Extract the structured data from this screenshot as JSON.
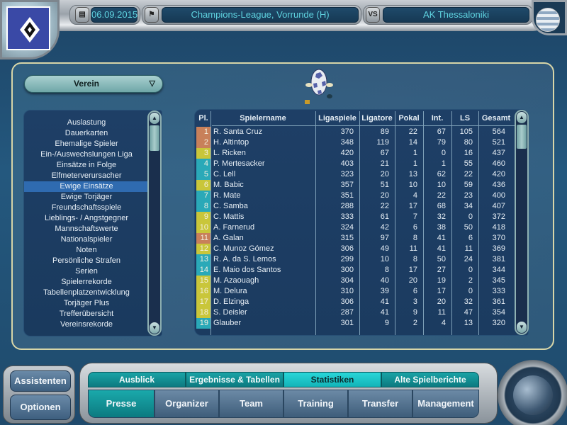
{
  "header": {
    "date": "06.09.2015",
    "competition": "Champions-League, Vorrunde (H)",
    "vs_label": "VS",
    "opponent": "AK Thessaloniki",
    "calendar_icon": "calendar-icon",
    "competition_icon": "flag-ball-icon",
    "club_crest": "hsv-diamond-crest",
    "opponent_flag": "greece-flag"
  },
  "category_dropdown": {
    "selected": "Verein",
    "arrow": "▽"
  },
  "stats_list": {
    "selected_index": 6,
    "items": [
      "Auslastung",
      "Dauerkarten",
      "Ehemalige Spieler",
      "Ein-/Auswechslungen Liga",
      "Einsätze in Folge",
      "Elfmeterverursacher",
      "Ewige Einsätze",
      "Ewige Torjäger",
      "Freundschaftsspiele",
      "Lieblings- / Angstgegner",
      "Mannschaftswerte",
      "Nationalspieler",
      "Noten",
      "Persönliche Strafen",
      "Serien",
      "Spielerrekorde",
      "Tabellenplatzentwicklung",
      "Torjäger Plus",
      "Trefferübersicht",
      "Vereinsrekorde"
    ],
    "scroll_up": "▲",
    "scroll_down": "▼"
  },
  "table": {
    "columns": [
      "Pl.",
      "Spielername",
      "Ligaspiele",
      "Ligatore",
      "Pokal",
      "Int.",
      "LS",
      "Gesamt"
    ],
    "position_colors": {
      "orange": "#c8805a",
      "yellow": "#c9c63a",
      "cyan": "#2aa9b8"
    },
    "rows": [
      {
        "pl": "1",
        "color": "orange",
        "name": "R. Santa Cruz",
        "liga": "370",
        "tore": "89",
        "pokal": "22",
        "int": "67",
        "ls": "105",
        "gesamt": "564"
      },
      {
        "pl": "2",
        "color": "orange",
        "name": "H. Altintop",
        "liga": "348",
        "tore": "119",
        "pokal": "14",
        "int": "79",
        "ls": "80",
        "gesamt": "521"
      },
      {
        "pl": "3",
        "color": "yellow",
        "name": "L. Ricken",
        "liga": "420",
        "tore": "67",
        "pokal": "1",
        "int": "0",
        "ls": "16",
        "gesamt": "437"
      },
      {
        "pl": "4",
        "color": "cyan",
        "name": "P. Mertesacker",
        "liga": "403",
        "tore": "21",
        "pokal": "1",
        "int": "1",
        "ls": "55",
        "gesamt": "460"
      },
      {
        "pl": "5",
        "color": "cyan",
        "name": "C. Lell",
        "liga": "323",
        "tore": "20",
        "pokal": "13",
        "int": "62",
        "ls": "22",
        "gesamt": "420"
      },
      {
        "pl": "6",
        "color": "yellow",
        "name": "M. Babic",
        "liga": "357",
        "tore": "51",
        "pokal": "10",
        "int": "10",
        "ls": "59",
        "gesamt": "436"
      },
      {
        "pl": "7",
        "color": "cyan",
        "name": "R. Mate",
        "liga": "351",
        "tore": "20",
        "pokal": "4",
        "int": "22",
        "ls": "23",
        "gesamt": "400"
      },
      {
        "pl": "8",
        "color": "cyan",
        "name": "C. Samba",
        "liga": "288",
        "tore": "22",
        "pokal": "17",
        "int": "68",
        "ls": "34",
        "gesamt": "407"
      },
      {
        "pl": "9",
        "color": "yellow",
        "name": "C. Mattis",
        "liga": "333",
        "tore": "61",
        "pokal": "7",
        "int": "32",
        "ls": "0",
        "gesamt": "372"
      },
      {
        "pl": "10",
        "color": "yellow",
        "name": "A. Farnerud",
        "liga": "324",
        "tore": "42",
        "pokal": "6",
        "int": "38",
        "ls": "50",
        "gesamt": "418"
      },
      {
        "pl": "11",
        "color": "orange",
        "name": "A. Galan",
        "liga": "315",
        "tore": "97",
        "pokal": "8",
        "int": "41",
        "ls": "6",
        "gesamt": "370"
      },
      {
        "pl": "12",
        "color": "yellow",
        "name": "C. Munoz Gómez",
        "liga": "306",
        "tore": "49",
        "pokal": "11",
        "int": "41",
        "ls": "11",
        "gesamt": "369"
      },
      {
        "pl": "13",
        "color": "cyan",
        "name": "R. A. da S. Lemos",
        "liga": "299",
        "tore": "10",
        "pokal": "8",
        "int": "50",
        "ls": "24",
        "gesamt": "381"
      },
      {
        "pl": "14",
        "color": "cyan",
        "name": "E. Maio dos Santos",
        "liga": "300",
        "tore": "8",
        "pokal": "17",
        "int": "27",
        "ls": "0",
        "gesamt": "344"
      },
      {
        "pl": "15",
        "color": "yellow",
        "name": "M. Azaouagh",
        "liga": "304",
        "tore": "40",
        "pokal": "20",
        "int": "19",
        "ls": "2",
        "gesamt": "345"
      },
      {
        "pl": "16",
        "color": "yellow",
        "name": "M. Delura",
        "liga": "310",
        "tore": "39",
        "pokal": "6",
        "int": "17",
        "ls": "0",
        "gesamt": "333"
      },
      {
        "pl": "17",
        "color": "yellow",
        "name": "D. Elzinga",
        "liga": "306",
        "tore": "41",
        "pokal": "3",
        "int": "20",
        "ls": "32",
        "gesamt": "361"
      },
      {
        "pl": "18",
        "color": "yellow",
        "name": "S. Deisler",
        "liga": "287",
        "tore": "41",
        "pokal": "9",
        "int": "11",
        "ls": "47",
        "gesamt": "354"
      },
      {
        "pl": "19",
        "color": "cyan",
        "name": "Glauber",
        "liga": "301",
        "tore": "9",
        "pokal": "2",
        "int": "4",
        "ls": "13",
        "gesamt": "320"
      }
    ]
  },
  "bottom_left": {
    "assistants": "Assistenten",
    "options": "Optionen"
  },
  "sub_tabs": [
    {
      "label": "Ausblick",
      "active": false
    },
    {
      "label": "Ergebnisse & Tabellen",
      "active": false
    },
    {
      "label": "Statistiken",
      "active": true
    },
    {
      "label": "Alte Spielberichte",
      "active": false
    }
  ],
  "main_tabs": [
    {
      "label": "Presse",
      "active": true
    },
    {
      "label": "Organizer",
      "active": false
    },
    {
      "label": "Team",
      "active": false
    },
    {
      "label": "Training",
      "active": false
    },
    {
      "label": "Transfer",
      "active": false
    },
    {
      "label": "Management",
      "active": false
    }
  ]
}
